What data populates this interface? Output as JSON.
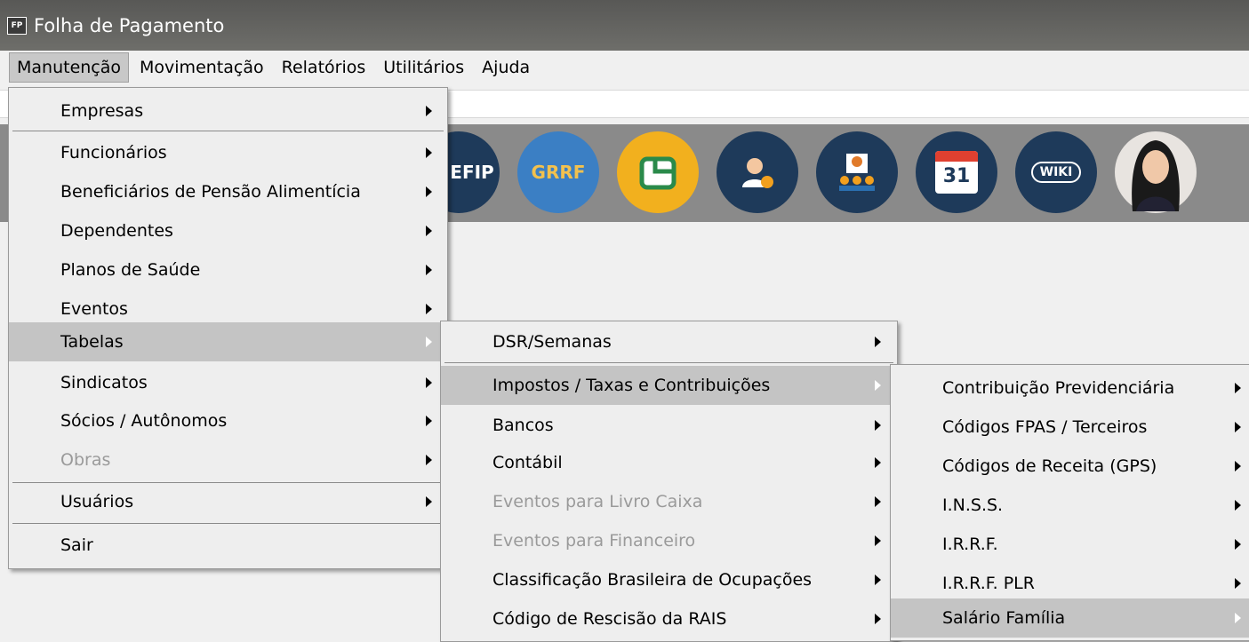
{
  "window": {
    "icon_text": "FP",
    "title": "Folha de Pagamento"
  },
  "menubar": {
    "items": [
      "Manutenção",
      "Movimentação",
      "Relatórios",
      "Utilitários",
      "Ajuda"
    ]
  },
  "toolbar": {
    "icons": [
      {
        "name": "sefip-icon",
        "text": "EFIP"
      },
      {
        "name": "grrf-icon",
        "text": "GRRF"
      },
      {
        "name": "document-icon",
        "text": ""
      },
      {
        "name": "support-agent-icon",
        "text": ""
      },
      {
        "name": "users-group-icon",
        "text": ""
      },
      {
        "name": "calendar-icon",
        "text": "31"
      },
      {
        "name": "wiki-icon",
        "text": "WIKI"
      },
      {
        "name": "assistant-avatar-icon",
        "text": ""
      }
    ]
  },
  "menu_manutencao": {
    "items": [
      "Empresas",
      "Funcionários",
      "Beneficiários de Pensão Alimentícia",
      "Dependentes",
      "Planos de Saúde",
      "Eventos",
      "Tabelas",
      "Sindicatos",
      "Sócios / Autônomos",
      "Obras",
      "Usuários",
      "Sair"
    ]
  },
  "menu_tabelas": {
    "items": [
      "DSR/Semanas",
      "Impostos / Taxas e Contribuições",
      "Bancos",
      "Contábil",
      "Eventos para Livro Caixa",
      "Eventos para Financeiro",
      "Classificação Brasileira de Ocupações",
      "Código de Rescisão da RAIS"
    ]
  },
  "menu_impostos": {
    "items": [
      "Contribuição Previdenciária",
      "Códigos FPAS / Terceiros",
      "Códigos de Receita (GPS)",
      "I.N.S.S.",
      "I.R.R.F.",
      "I.R.R.F. PLR",
      "Salário Família"
    ]
  },
  "colors": {
    "titlebar": "#5c5c5a",
    "toolbar": "#8a8a8a",
    "menu_bg": "#eeeeee",
    "highlight": "#c4c4c4",
    "disabled": "#9a9a9a"
  }
}
